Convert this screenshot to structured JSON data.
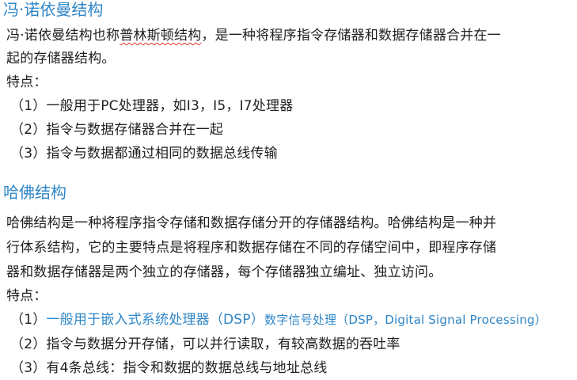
{
  "von_neumann": {
    "heading": "冯·诺依曼结构",
    "desc_part1": "冯·诺依曼结构也称",
    "desc_link": "普林斯顿结构",
    "desc_part2": "，是一种将程序指令存储器和数据存储器合并在一",
    "desc_line2": "起的存储器结构。",
    "features_label": "特点：",
    "features": [
      "（1）一般用于PC处理器，如I3，I5，I7处理器",
      "（2）指令与数据存储器合并在一起",
      "（3）指令与数据都通过相同的数据总线传输"
    ]
  },
  "harvard": {
    "heading": "哈佛结构",
    "desc_lines": [
      "哈佛结构是一种将程序指令存储和数据存储分开的存储器结构。哈佛结构是一种并",
      "行体系结构，它的主要特点是将程序和数据存储在不同的存储空间中，即程序存储",
      "器和数据存储器是两个独立的存储器，每个存储器独立编址、独立访问。"
    ],
    "features_label": "特点：",
    "feature1_prefix": "（1）",
    "feature1_link": "一般用于嵌入式系统处理器（DSP）",
    "feature1_note": "数字信号处理（DSP，Digital Signal Processing）",
    "features": [
      "（2）指令与数据分开存储，可以并行读取，有较高数据的吞吐率",
      "（3）有4条总线：指令和数据的数据总线与地址总线"
    ]
  }
}
